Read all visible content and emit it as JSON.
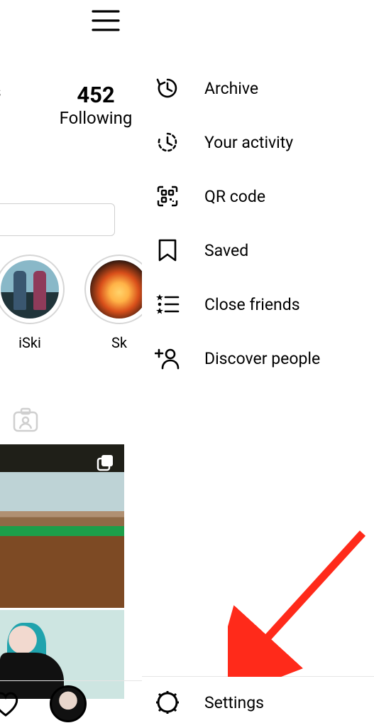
{
  "header": {
    "menu_button": "menu"
  },
  "profile": {
    "stats": {
      "followers_label": "ers",
      "following_count": "452",
      "following_label": "Following"
    },
    "highlights": [
      {
        "label": "iSki"
      },
      {
        "label": "Sk"
      }
    ]
  },
  "drawer": {
    "items": [
      {
        "icon": "archive-icon",
        "label": "Archive"
      },
      {
        "icon": "activity-icon",
        "label": "Your activity"
      },
      {
        "icon": "qr-icon",
        "label": "QR code"
      },
      {
        "icon": "saved-icon",
        "label": "Saved"
      },
      {
        "icon": "close-friends-icon",
        "label": "Close friends"
      },
      {
        "icon": "discover-icon",
        "label": "Discover people"
      }
    ],
    "footer": {
      "icon": "settings-icon",
      "label": "Settings"
    }
  },
  "annotation": {
    "arrow_target": "settings",
    "color": "#ff2a1a"
  }
}
